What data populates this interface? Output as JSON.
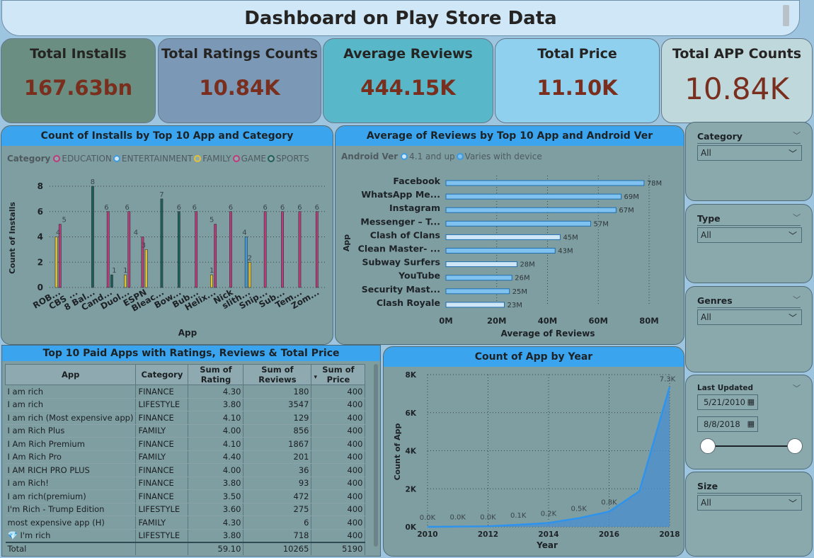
{
  "title": "Dashboard on Play Store Data",
  "kpis": [
    {
      "label": "Total Installs",
      "value": "167.63bn",
      "bg": "#6a8f82"
    },
    {
      "label": "Total Ratings Counts",
      "value": "10.84K",
      "bg": "#7b99b6"
    },
    {
      "label": "Average Reviews",
      "value": "444.15K",
      "bg": "#58b8c9"
    },
    {
      "label": "Total Price",
      "value": "11.10K",
      "bg": "#8fd0ef"
    },
    {
      "label": "Total APP Counts",
      "value": "10.84K",
      "bg": "#bfd8dc"
    }
  ],
  "installs_chart": {
    "title": "Count of Installs by Top 10 App and Category",
    "legend_title": "Category",
    "legend": [
      {
        "name": "EDUCATION",
        "color": "#bf3a7a"
      },
      {
        "name": "ENTERTAINMENT",
        "color": "#3d9be0"
      },
      {
        "name": "FAMILY",
        "color": "#e6c233"
      },
      {
        "name": "GAME",
        "color": "#bf3a7a"
      },
      {
        "name": "SPORTS",
        "color": "#1e5f5a"
      }
    ]
  },
  "reviews_chart": {
    "title": "Average of Reviews by Top 10 App and Android Ver",
    "legend_title": "Android Ver",
    "legend": [
      {
        "name": "4.1 and up",
        "color": "#3d9be0"
      },
      {
        "name": "Varies with device",
        "color": "#3d9be0"
      }
    ]
  },
  "paid_table": {
    "title": "Top 10 Paid Apps with Ratings, Reviews & Total Price",
    "columns": [
      "App",
      "Category",
      "Sum of Rating",
      "Sum of Reviews",
      "Sum of Price"
    ],
    "sort_indicator": "▾",
    "rows": [
      [
        "I am rich",
        "FINANCE",
        "4.30",
        "180",
        "400"
      ],
      [
        "I am rich",
        "LIFESTYLE",
        "3.80",
        "3547",
        "400"
      ],
      [
        "I am rich (Most expensive app)",
        "FINANCE",
        "4.10",
        "129",
        "400"
      ],
      [
        "I am Rich Plus",
        "FAMILY",
        "4.00",
        "856",
        "400"
      ],
      [
        "I Am Rich Premium",
        "FINANCE",
        "4.10",
        "1867",
        "400"
      ],
      [
        "I Am Rich Pro",
        "FAMILY",
        "4.40",
        "201",
        "400"
      ],
      [
        "I AM RICH PRO PLUS",
        "FINANCE",
        "4.00",
        "36",
        "400"
      ],
      [
        "I am Rich!",
        "FINANCE",
        "3.80",
        "93",
        "400"
      ],
      [
        "I am rich(premium)",
        "FINANCE",
        "3.50",
        "472",
        "400"
      ],
      [
        "I'm Rich - Trump Edition",
        "LIFESTYLE",
        "3.60",
        "275",
        "400"
      ],
      [
        "most expensive app (H)",
        "FAMILY",
        "4.30",
        "6",
        "400"
      ],
      [
        "💎 I'm rich",
        "LIFESTYLE",
        "3.80",
        "718",
        "400"
      ]
    ],
    "total": [
      "Total",
      "",
      "59.10",
      "10265",
      "5190"
    ]
  },
  "year_chart": {
    "title": "Count of App by Year"
  },
  "slicers": {
    "category": {
      "title": "Category",
      "value": "All"
    },
    "type": {
      "title": "Type",
      "value": "All"
    },
    "genres": {
      "title": "Genres",
      "value": "All"
    },
    "last_updated": {
      "title": "Last Updated",
      "from": "5/21/2010",
      "to": "8/8/2018"
    },
    "size": {
      "title": "Size",
      "value": "All"
    }
  },
  "chart_data": [
    {
      "type": "bar",
      "title": "Count of Installs by Top 10 App and Category",
      "xlabel": "App",
      "ylabel": "Count of Installs",
      "ylim": [
        0,
        8
      ],
      "yticks": [
        "0",
        "2",
        "4",
        "6",
        "8"
      ],
      "grid": true,
      "legend_position": "top-left",
      "categories": [
        "ROB...",
        "CBS ...",
        "8 Bal...",
        "Cand...",
        "Duol...",
        "ESPN",
        "Bleac...",
        "Bow...",
        "Bub...",
        "Helix...",
        "Nick",
        "slith...",
        "Snip...",
        "Sub...",
        "Tem...",
        "Zom..."
      ],
      "bars": [
        {
          "x": 0,
          "series": "FAMILY",
          "value": 4
        },
        {
          "x": 0,
          "series": "GAME",
          "value": 5
        },
        {
          "x": 2,
          "series": "SPORTS",
          "value": 8
        },
        {
          "x": 3,
          "series": "GAME",
          "value": 6
        },
        {
          "x": 3,
          "series": "SPORTS",
          "value": 1
        },
        {
          "x": 4,
          "series": "FAMILY",
          "value": 1
        },
        {
          "x": 4,
          "series": "GAME",
          "value": 6
        },
        {
          "x": 5,
          "series": "EDUCATION",
          "value": 4
        },
        {
          "x": 5,
          "series": "FAMILY",
          "value": 3
        },
        {
          "x": 6,
          "series": "SPORTS",
          "value": 7
        },
        {
          "x": 7,
          "series": "SPORTS",
          "value": 6
        },
        {
          "x": 8,
          "series": "GAME",
          "value": 6
        },
        {
          "x": 9,
          "series": "FAMILY",
          "value": 1
        },
        {
          "x": 9,
          "series": "GAME",
          "value": 5
        },
        {
          "x": 10,
          "series": "GAME",
          "value": 6
        },
        {
          "x": 11,
          "series": "ENTERTAINMENT",
          "value": 4
        },
        {
          "x": 11,
          "series": "FAMILY",
          "value": 2
        },
        {
          "x": 12,
          "series": "GAME",
          "value": 6
        },
        {
          "x": 13,
          "series": "GAME",
          "value": 6
        },
        {
          "x": 14,
          "series": "GAME",
          "value": 6
        },
        {
          "x": 15,
          "series": "GAME",
          "value": 6
        }
      ],
      "labels": [
        {
          "x": 0.0,
          "v": 4,
          "text": "4"
        },
        {
          "x": 0.35,
          "v": 5,
          "text": "5"
        },
        {
          "x": 2.0,
          "v": 8,
          "text": "8"
        },
        {
          "x": 2.8,
          "v": 6,
          "text": "6"
        },
        {
          "x": 3.25,
          "v": 1,
          "text": "1"
        },
        {
          "x": 3.9,
          "v": 1,
          "text": "1"
        },
        {
          "x": 4.0,
          "v": 6,
          "text": "6"
        },
        {
          "x": 4.5,
          "v": 4,
          "text": "4"
        },
        {
          "x": 4.95,
          "v": 3,
          "text": "3"
        },
        {
          "x": 6.0,
          "v": 7,
          "text": "7"
        },
        {
          "x": 7.0,
          "v": 6,
          "text": "6"
        },
        {
          "x": 7.9,
          "v": 6,
          "text": "6"
        },
        {
          "x": 8.9,
          "v": 1,
          "text": "1"
        },
        {
          "x": 8.9,
          "v": 5,
          "text": "5"
        },
        {
          "x": 10.0,
          "v": 6,
          "text": "6"
        },
        {
          "x": 10.8,
          "v": 4,
          "text": "4"
        },
        {
          "x": 11.1,
          "v": 2,
          "text": "2"
        },
        {
          "x": 12.0,
          "v": 6,
          "text": "6"
        },
        {
          "x": 13.0,
          "v": 6,
          "text": "6"
        },
        {
          "x": 14.0,
          "v": 6,
          "text": "6"
        },
        {
          "x": 15.0,
          "v": 6,
          "text": "6"
        }
      ]
    },
    {
      "type": "bar",
      "orientation": "horizontal",
      "title": "Average of Reviews by Top 10 App and Android Ver",
      "xlabel": "Average of Reviews",
      "ylabel": "App",
      "xlim": [
        0,
        80000000
      ],
      "xticks": [
        "0M",
        "20M",
        "40M",
        "60M",
        "80M"
      ],
      "grid": true,
      "legend_position": "top-left",
      "rows": [
        {
          "app": "Facebook",
          "values": [
            {
              "series": "Varies with device",
              "value": 78000000,
              "label": "78M"
            }
          ]
        },
        {
          "app": "WhatsApp Me...",
          "values": [
            {
              "series": "Varies with device",
              "value": 69000000,
              "label": "69M"
            }
          ]
        },
        {
          "app": "Instagram",
          "values": [
            {
              "series": "Varies with device",
              "value": 67000000,
              "label": "67M"
            }
          ]
        },
        {
          "app": "Messenger – T...",
          "values": [
            {
              "series": "Varies with device",
              "value": 57000000,
              "label": "57M"
            }
          ]
        },
        {
          "app": "Clash of Clans",
          "values": [
            {
              "series": "4.1 and up",
              "value": 45000000,
              "label": "45M"
            }
          ]
        },
        {
          "app": "Clean Master- ...",
          "values": [
            {
              "series": "Varies with device",
              "value": 43000000,
              "label": "43M"
            }
          ]
        },
        {
          "app": "Subway Surfers",
          "values": [
            {
              "series": "4.1 and up",
              "value": 28000000,
              "label": "28M"
            }
          ]
        },
        {
          "app": "YouTube",
          "values": [
            {
              "series": "Varies with device",
              "value": 26000000,
              "label": "26M"
            }
          ]
        },
        {
          "app": "Security Mast...",
          "values": [
            {
              "series": "Varies with device",
              "value": 25000000,
              "label": "25M"
            }
          ]
        },
        {
          "app": "Clash Royale",
          "values": [
            {
              "series": "4.1 and up",
              "value": 23000000,
              "label": "23M"
            }
          ]
        }
      ]
    },
    {
      "type": "area",
      "title": "Count of App by Year",
      "xlabel": "Year",
      "ylabel": "Count of App",
      "xlim": [
        2010,
        2018
      ],
      "ylim": [
        0,
        8000
      ],
      "xticks": [
        "2010",
        "2012",
        "2014",
        "2016",
        "2018"
      ],
      "yticks": [
        "0K",
        "2K",
        "4K",
        "6K",
        "8K"
      ],
      "grid": true,
      "x": [
        2010,
        2011,
        2012,
        2013,
        2014,
        2015,
        2016,
        2017,
        2018
      ],
      "y": [
        1,
        15,
        26,
        110,
        203,
        459,
        801,
        1867,
        7350
      ],
      "labels": [
        "0.0K",
        "0.0K",
        "0.0K",
        "0.1K",
        "0.2K",
        "0.5K",
        "0.8K",
        "",
        "7.3K"
      ]
    }
  ]
}
